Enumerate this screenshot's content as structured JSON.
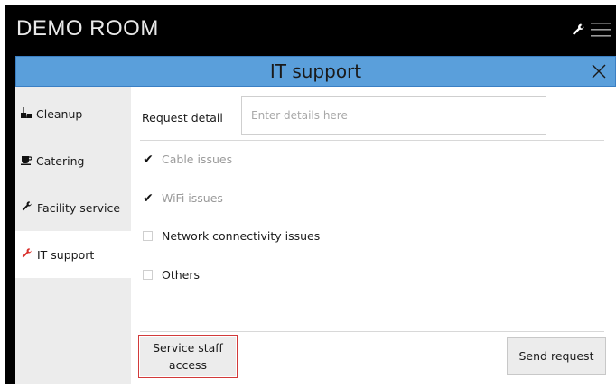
{
  "header": {
    "room_title": "DEMO ROOM",
    "icons": [
      "wrench-icon",
      "hamburger-menu-icon"
    ]
  },
  "dialog": {
    "title": "IT support",
    "close_icon": "close-icon"
  },
  "sidebar": {
    "items": [
      {
        "label": "Cleanup",
        "icon": "broom-icon",
        "active": false
      },
      {
        "label": "Catering",
        "icon": "coffee-cup-icon",
        "active": false
      },
      {
        "label": "Facility service",
        "icon": "wrench-icon",
        "active": false
      },
      {
        "label": "IT support",
        "icon": "wrench-icon",
        "active": true
      }
    ]
  },
  "form": {
    "request_label": "Request detail",
    "request_placeholder": "Enter details here",
    "request_value": "",
    "options": [
      {
        "label": "Cable issues",
        "checked": true
      },
      {
        "label": "WiFi issues",
        "checked": true
      },
      {
        "label": "Network connectivity issues",
        "checked": false
      },
      {
        "label": "Others",
        "checked": false
      }
    ]
  },
  "buttons": {
    "service_staff_line1": "Service staff",
    "service_staff_line2": "access",
    "send_request": "Send request"
  },
  "colors": {
    "header_blue": "#5a9fdb",
    "active_icon_red": "#d9302c",
    "highlight_border": "#d23a3a",
    "background_black": "#000000"
  }
}
